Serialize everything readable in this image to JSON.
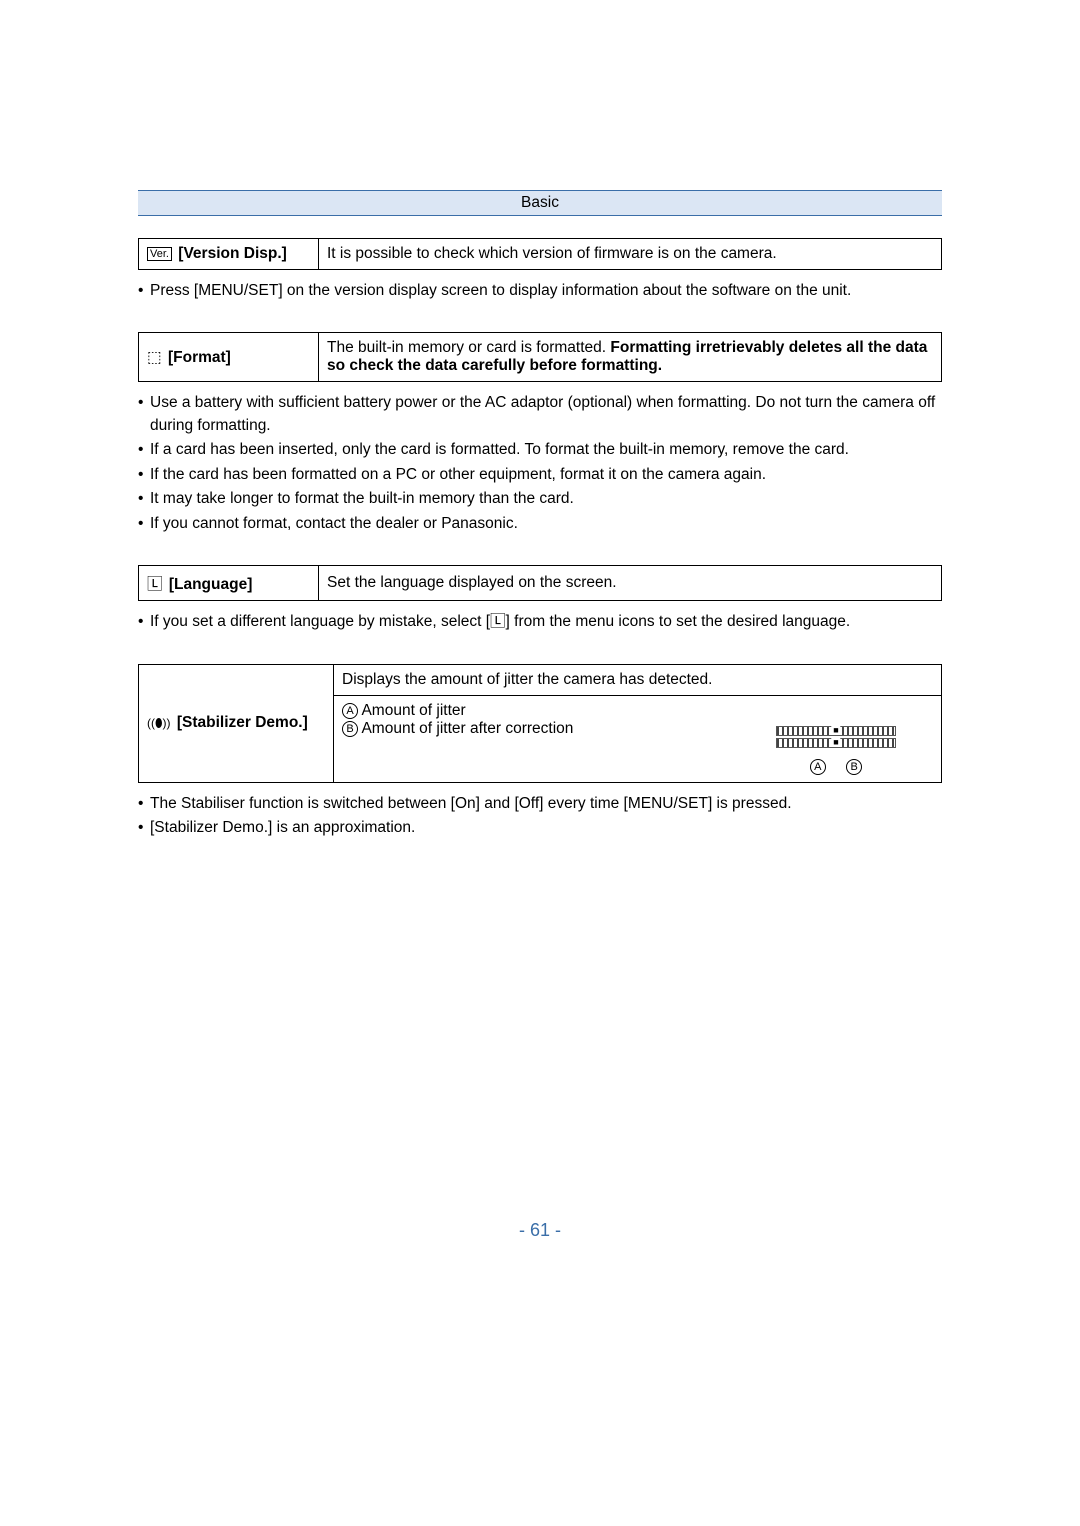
{
  "header": {
    "title": "Basic"
  },
  "version": {
    "icon": "Ver.",
    "label": "[Version Disp.]",
    "desc": "It is possible to check which version of firmware is on the camera.",
    "notes": [
      "Press [MENU/SET] on the version display screen to display information about the software on the unit."
    ]
  },
  "format": {
    "icon": "⬚",
    "label": "[Format]",
    "desc_prefix": "The built-in memory or card is formatted. ",
    "desc_bold": "Formatting irretrievably deletes all the data so check the data carefully before formatting.",
    "notes": [
      "Use a battery with sufficient battery power or the AC adaptor (optional) when formatting. Do not turn the camera off during formatting.",
      "If a card has been inserted, only the card is formatted. To format the built-in memory, remove the card.",
      "If the card has been formatted on a PC or other equipment, format it on the camera again.",
      "It may take longer to format the built-in memory than the card.",
      "If you cannot format, contact the dealer or Panasonic."
    ]
  },
  "language": {
    "icon": "🄻",
    "label": "[Language]",
    "desc": "Set the language displayed on the screen.",
    "notes": [
      "If you set a different language by mistake, select [🄻] from the menu icons to set the desired language."
    ]
  },
  "stabilizer": {
    "icon": "((⬮))",
    "label": "[Stabilizer Demo.]",
    "top_desc": "Displays the amount of jitter the camera has detected.",
    "item_a_marker": "A",
    "item_a": "Amount of jitter",
    "item_b_marker": "B",
    "item_b": "Amount of jitter after correction",
    "diagram": {
      "marker_a": "A",
      "marker_b": "B"
    },
    "notes": [
      "The Stabiliser function is switched between [On] and [Off] every time [MENU/SET] is pressed.",
      "[Stabilizer Demo.] is an approximation."
    ]
  },
  "page_number": "- 61 -"
}
